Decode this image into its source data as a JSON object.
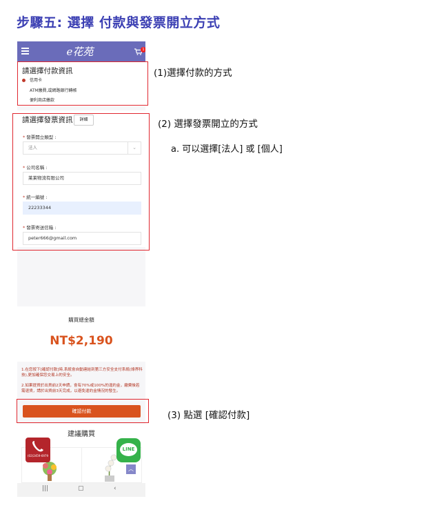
{
  "page_title": "步驟五: 選擇 付款與發票開立方式",
  "app": {
    "logo_text": "e花苑",
    "cart_badge": "1"
  },
  "payment": {
    "title": "請選擇付款資訊",
    "options": [
      {
        "label": "信用卡",
        "selected": true
      },
      {
        "label": "ATM繳費,或網路銀行轉帳",
        "selected": false
      },
      {
        "label": "便利商店繳款",
        "selected": false
      }
    ]
  },
  "invoice": {
    "title": "請選擇發票資訊",
    "detail_button": "詳細",
    "type_label": "發票開立類型 :",
    "type_value": "法人",
    "company_label": "公司名稱 :",
    "company_value": "莱莱物流有限公司",
    "taxid_label": "統一編號 :",
    "taxid_value": "22233344",
    "email_label": "發票寄送信箱 :",
    "email_value": "peter666@gmail.com"
  },
  "total": {
    "label": "購買總金額",
    "amount": "NT$2,190"
  },
  "notice": {
    "line1": "1.在您按下[確認付款]時,系統會自動連結到第三方安全支付系統(綠界科技),更加確保您交易上的安全。",
    "line2": "2.如果提貨於出貨前2天申請，會有70%或100%的違約金，繳費後若需退貨，請於出貨前3天完成，以避免違約金情況的發生。"
  },
  "confirm_button": "確認付款",
  "recommend_title": "建議購買",
  "phone_number": "(02)2459-6979",
  "line_label": "LINE",
  "annotations": {
    "a1": "(1)選擇付款的方式",
    "a2": "(2) 選擇發票開立的方式",
    "a2_sub": "a. 可以選擇[法人] 或 [個人]",
    "a3": "(3) 點選 [確認付款]"
  },
  "colors": {
    "title": "#3b3fb3",
    "appbar": "#6a6cba",
    "accent": "#d9531e",
    "annotation_box": "#e0262e"
  }
}
